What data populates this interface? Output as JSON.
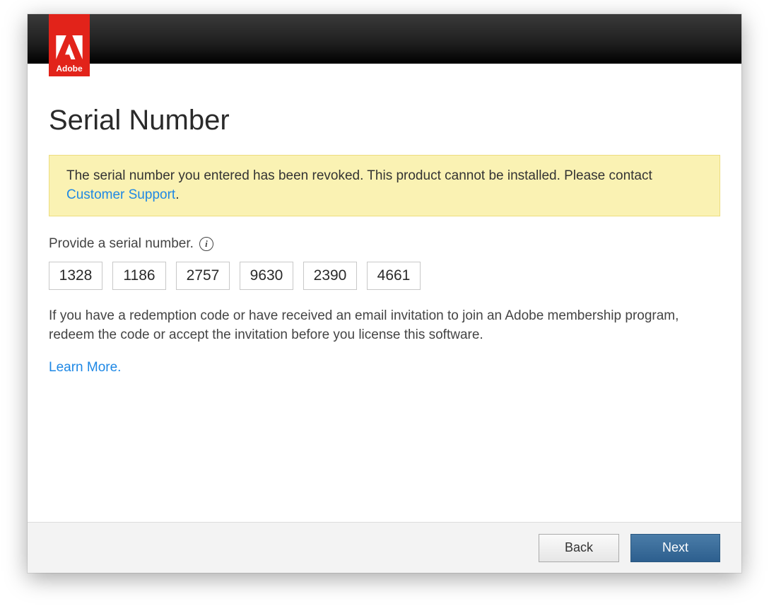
{
  "logo": {
    "brand": "Adobe"
  },
  "page": {
    "title": "Serial Number"
  },
  "warning": {
    "message_prefix": "The serial number you entered has been revoked. This product cannot be installed. Please contact ",
    "link_text": "Customer Support",
    "message_suffix": "."
  },
  "serial": {
    "label": "Provide a serial number.",
    "fields": [
      "1328",
      "1186",
      "2757",
      "9630",
      "2390",
      "4661"
    ]
  },
  "help": {
    "text": "If you have a redemption code or have received an email invitation to join an Adobe membership program, redeem the code or accept the invitation before you license this software.",
    "learn_more": "Learn More."
  },
  "footer": {
    "back": "Back",
    "next": "Next"
  }
}
